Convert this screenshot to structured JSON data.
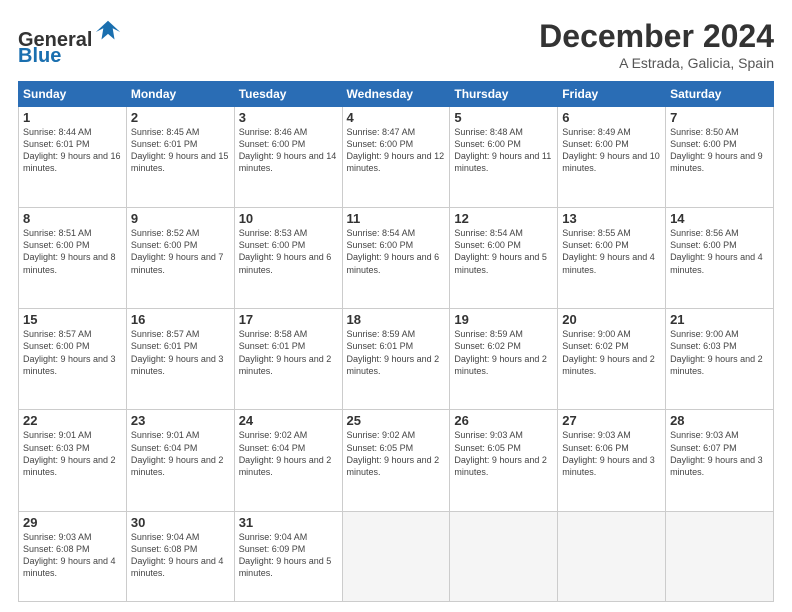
{
  "header": {
    "logo_line1": "General",
    "logo_line2": "Blue",
    "title": "December 2024",
    "subtitle": "A Estrada, Galicia, Spain"
  },
  "weekdays": [
    "Sunday",
    "Monday",
    "Tuesday",
    "Wednesday",
    "Thursday",
    "Friday",
    "Saturday"
  ],
  "weeks": [
    [
      {
        "day": "1",
        "info": "Sunrise: 8:44 AM\nSunset: 6:01 PM\nDaylight: 9 hours and 16 minutes."
      },
      {
        "day": "2",
        "info": "Sunrise: 8:45 AM\nSunset: 6:01 PM\nDaylight: 9 hours and 15 minutes."
      },
      {
        "day": "3",
        "info": "Sunrise: 8:46 AM\nSunset: 6:00 PM\nDaylight: 9 hours and 14 minutes."
      },
      {
        "day": "4",
        "info": "Sunrise: 8:47 AM\nSunset: 6:00 PM\nDaylight: 9 hours and 12 minutes."
      },
      {
        "day": "5",
        "info": "Sunrise: 8:48 AM\nSunset: 6:00 PM\nDaylight: 9 hours and 11 minutes."
      },
      {
        "day": "6",
        "info": "Sunrise: 8:49 AM\nSunset: 6:00 PM\nDaylight: 9 hours and 10 minutes."
      },
      {
        "day": "7",
        "info": "Sunrise: 8:50 AM\nSunset: 6:00 PM\nDaylight: 9 hours and 9 minutes."
      }
    ],
    [
      {
        "day": "8",
        "info": "Sunrise: 8:51 AM\nSunset: 6:00 PM\nDaylight: 9 hours and 8 minutes."
      },
      {
        "day": "9",
        "info": "Sunrise: 8:52 AM\nSunset: 6:00 PM\nDaylight: 9 hours and 7 minutes."
      },
      {
        "day": "10",
        "info": "Sunrise: 8:53 AM\nSunset: 6:00 PM\nDaylight: 9 hours and 6 minutes."
      },
      {
        "day": "11",
        "info": "Sunrise: 8:54 AM\nSunset: 6:00 PM\nDaylight: 9 hours and 6 minutes."
      },
      {
        "day": "12",
        "info": "Sunrise: 8:54 AM\nSunset: 6:00 PM\nDaylight: 9 hours and 5 minutes."
      },
      {
        "day": "13",
        "info": "Sunrise: 8:55 AM\nSunset: 6:00 PM\nDaylight: 9 hours and 4 minutes."
      },
      {
        "day": "14",
        "info": "Sunrise: 8:56 AM\nSunset: 6:00 PM\nDaylight: 9 hours and 4 minutes."
      }
    ],
    [
      {
        "day": "15",
        "info": "Sunrise: 8:57 AM\nSunset: 6:00 PM\nDaylight: 9 hours and 3 minutes."
      },
      {
        "day": "16",
        "info": "Sunrise: 8:57 AM\nSunset: 6:01 PM\nDaylight: 9 hours and 3 minutes."
      },
      {
        "day": "17",
        "info": "Sunrise: 8:58 AM\nSunset: 6:01 PM\nDaylight: 9 hours and 2 minutes."
      },
      {
        "day": "18",
        "info": "Sunrise: 8:59 AM\nSunset: 6:01 PM\nDaylight: 9 hours and 2 minutes."
      },
      {
        "day": "19",
        "info": "Sunrise: 8:59 AM\nSunset: 6:02 PM\nDaylight: 9 hours and 2 minutes."
      },
      {
        "day": "20",
        "info": "Sunrise: 9:00 AM\nSunset: 6:02 PM\nDaylight: 9 hours and 2 minutes."
      },
      {
        "day": "21",
        "info": "Sunrise: 9:00 AM\nSunset: 6:03 PM\nDaylight: 9 hours and 2 minutes."
      }
    ],
    [
      {
        "day": "22",
        "info": "Sunrise: 9:01 AM\nSunset: 6:03 PM\nDaylight: 9 hours and 2 minutes."
      },
      {
        "day": "23",
        "info": "Sunrise: 9:01 AM\nSunset: 6:04 PM\nDaylight: 9 hours and 2 minutes."
      },
      {
        "day": "24",
        "info": "Sunrise: 9:02 AM\nSunset: 6:04 PM\nDaylight: 9 hours and 2 minutes."
      },
      {
        "day": "25",
        "info": "Sunrise: 9:02 AM\nSunset: 6:05 PM\nDaylight: 9 hours and 2 minutes."
      },
      {
        "day": "26",
        "info": "Sunrise: 9:03 AM\nSunset: 6:05 PM\nDaylight: 9 hours and 2 minutes."
      },
      {
        "day": "27",
        "info": "Sunrise: 9:03 AM\nSunset: 6:06 PM\nDaylight: 9 hours and 3 minutes."
      },
      {
        "day": "28",
        "info": "Sunrise: 9:03 AM\nSunset: 6:07 PM\nDaylight: 9 hours and 3 minutes."
      }
    ],
    [
      {
        "day": "29",
        "info": "Sunrise: 9:03 AM\nSunset: 6:08 PM\nDaylight: 9 hours and 4 minutes."
      },
      {
        "day": "30",
        "info": "Sunrise: 9:04 AM\nSunset: 6:08 PM\nDaylight: 9 hours and 4 minutes."
      },
      {
        "day": "31",
        "info": "Sunrise: 9:04 AM\nSunset: 6:09 PM\nDaylight: 9 hours and 5 minutes."
      },
      {
        "day": "",
        "info": ""
      },
      {
        "day": "",
        "info": ""
      },
      {
        "day": "",
        "info": ""
      },
      {
        "day": "",
        "info": ""
      }
    ]
  ]
}
